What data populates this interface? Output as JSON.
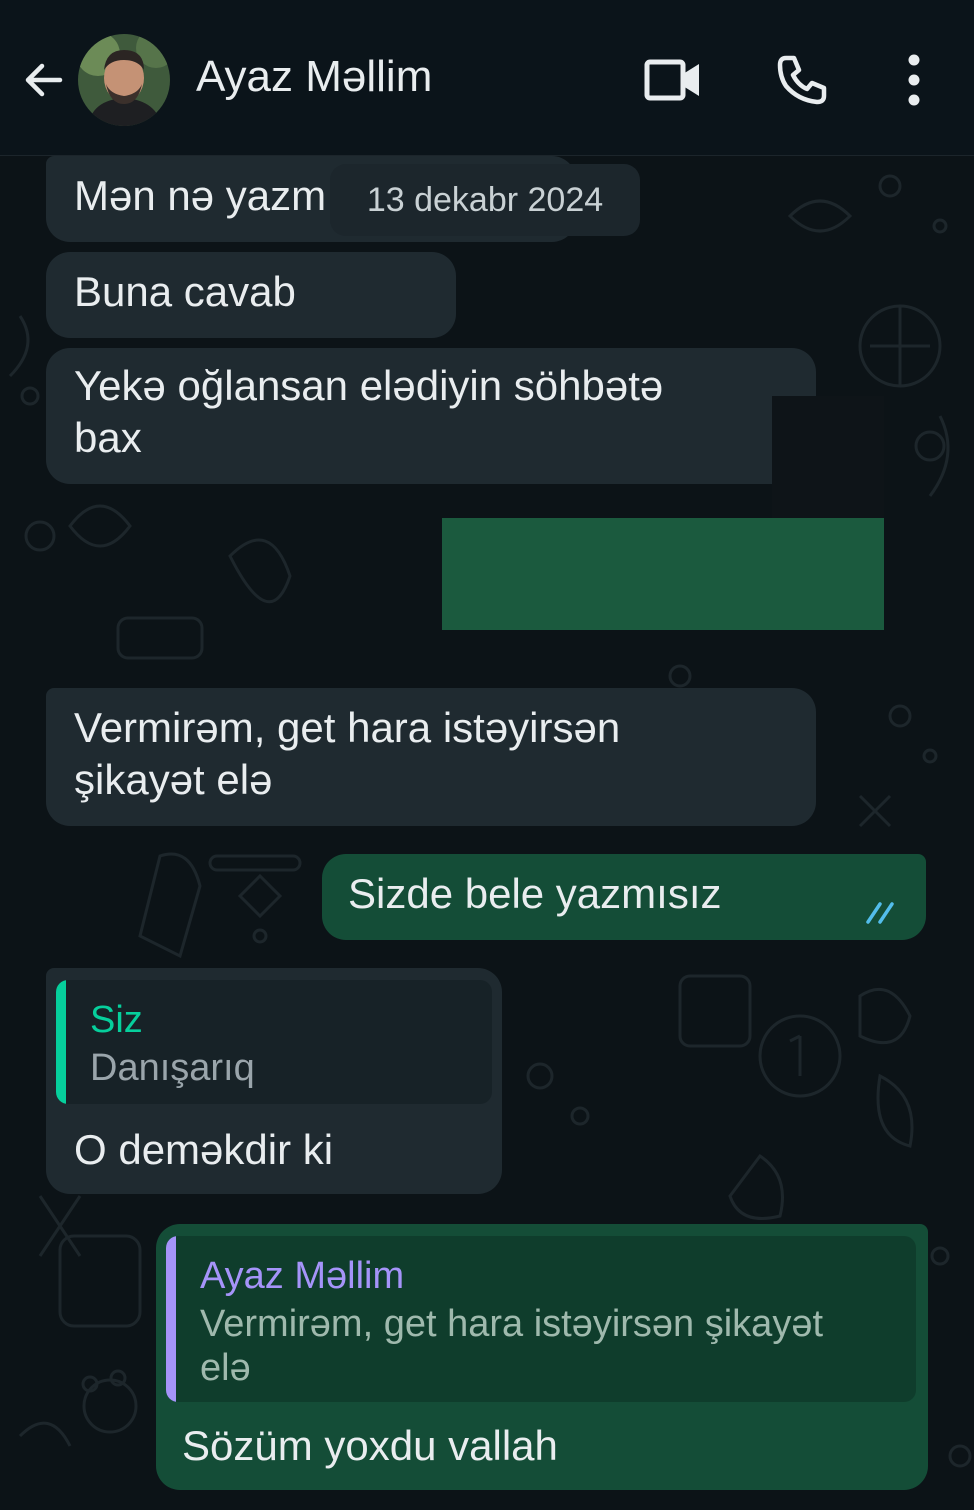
{
  "header": {
    "contact_name": "Ayaz Məllim",
    "back_icon": "arrow-left-icon",
    "video_icon": "video-camera-icon",
    "call_icon": "phone-icon",
    "menu_icon": "more-vertical-icon"
  },
  "date_chip": "13 dekabr 2024",
  "messages": [
    {
      "direction": "in",
      "text": "Mən nə yazm"
    },
    {
      "direction": "in",
      "text": "Buna cavab"
    },
    {
      "direction": "in",
      "text": "Yekə oğlansan elədiyin söhbətə\nbax"
    },
    {
      "direction": "in",
      "text": "Vermirəm, get hara istəyirsən\nşikayət elə"
    },
    {
      "direction": "out",
      "text": "Sizde bele yazmısız",
      "status": "read"
    },
    {
      "direction": "in",
      "reply_to": {
        "name": "Siz",
        "text": "Danışarıq"
      },
      "text": "O deməkdir ki"
    },
    {
      "direction": "out",
      "reply_to": {
        "name": "Ayaz Məllim",
        "text": "Vermirəm, get hara istəyirsən şikayət\nelə"
      },
      "text": "Sözüm yoxdu vallah"
    }
  ],
  "colors": {
    "incoming_bubble": "#1f2a30",
    "outgoing_bubble": "#144d37",
    "read_ticks": "#53bdeb",
    "reply_self": "#06cf9c",
    "reply_contact": "#a594f9"
  }
}
